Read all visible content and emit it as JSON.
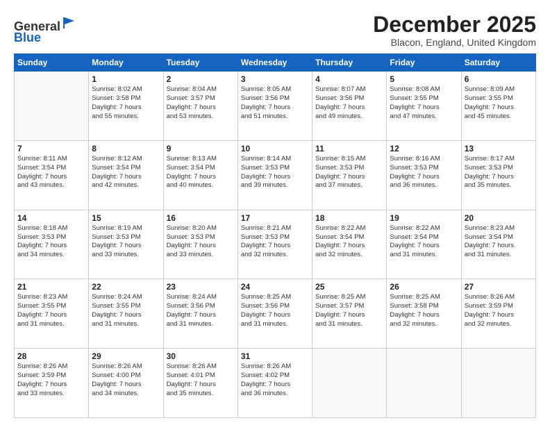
{
  "header": {
    "logo_general": "General",
    "logo_blue": "Blue",
    "month_title": "December 2025",
    "location": "Blacon, England, United Kingdom"
  },
  "days_of_week": [
    "Sunday",
    "Monday",
    "Tuesday",
    "Wednesday",
    "Thursday",
    "Friday",
    "Saturday"
  ],
  "weeks": [
    [
      {
        "day": "",
        "info": ""
      },
      {
        "day": "1",
        "info": "Sunrise: 8:02 AM\nSunset: 3:58 PM\nDaylight: 7 hours\nand 55 minutes."
      },
      {
        "day": "2",
        "info": "Sunrise: 8:04 AM\nSunset: 3:57 PM\nDaylight: 7 hours\nand 53 minutes."
      },
      {
        "day": "3",
        "info": "Sunrise: 8:05 AM\nSunset: 3:56 PM\nDaylight: 7 hours\nand 51 minutes."
      },
      {
        "day": "4",
        "info": "Sunrise: 8:07 AM\nSunset: 3:56 PM\nDaylight: 7 hours\nand 49 minutes."
      },
      {
        "day": "5",
        "info": "Sunrise: 8:08 AM\nSunset: 3:55 PM\nDaylight: 7 hours\nand 47 minutes."
      },
      {
        "day": "6",
        "info": "Sunrise: 8:09 AM\nSunset: 3:55 PM\nDaylight: 7 hours\nand 45 minutes."
      }
    ],
    [
      {
        "day": "7",
        "info": "Sunrise: 8:11 AM\nSunset: 3:54 PM\nDaylight: 7 hours\nand 43 minutes."
      },
      {
        "day": "8",
        "info": "Sunrise: 8:12 AM\nSunset: 3:54 PM\nDaylight: 7 hours\nand 42 minutes."
      },
      {
        "day": "9",
        "info": "Sunrise: 8:13 AM\nSunset: 3:54 PM\nDaylight: 7 hours\nand 40 minutes."
      },
      {
        "day": "10",
        "info": "Sunrise: 8:14 AM\nSunset: 3:53 PM\nDaylight: 7 hours\nand 39 minutes."
      },
      {
        "day": "11",
        "info": "Sunrise: 8:15 AM\nSunset: 3:53 PM\nDaylight: 7 hours\nand 37 minutes."
      },
      {
        "day": "12",
        "info": "Sunrise: 8:16 AM\nSunset: 3:53 PM\nDaylight: 7 hours\nand 36 minutes."
      },
      {
        "day": "13",
        "info": "Sunrise: 8:17 AM\nSunset: 3:53 PM\nDaylight: 7 hours\nand 35 minutes."
      }
    ],
    [
      {
        "day": "14",
        "info": "Sunrise: 8:18 AM\nSunset: 3:53 PM\nDaylight: 7 hours\nand 34 minutes."
      },
      {
        "day": "15",
        "info": "Sunrise: 8:19 AM\nSunset: 3:53 PM\nDaylight: 7 hours\nand 33 minutes."
      },
      {
        "day": "16",
        "info": "Sunrise: 8:20 AM\nSunset: 3:53 PM\nDaylight: 7 hours\nand 33 minutes."
      },
      {
        "day": "17",
        "info": "Sunrise: 8:21 AM\nSunset: 3:53 PM\nDaylight: 7 hours\nand 32 minutes."
      },
      {
        "day": "18",
        "info": "Sunrise: 8:22 AM\nSunset: 3:54 PM\nDaylight: 7 hours\nand 32 minutes."
      },
      {
        "day": "19",
        "info": "Sunrise: 8:22 AM\nSunset: 3:54 PM\nDaylight: 7 hours\nand 31 minutes."
      },
      {
        "day": "20",
        "info": "Sunrise: 8:23 AM\nSunset: 3:54 PM\nDaylight: 7 hours\nand 31 minutes."
      }
    ],
    [
      {
        "day": "21",
        "info": "Sunrise: 8:23 AM\nSunset: 3:55 PM\nDaylight: 7 hours\nand 31 minutes."
      },
      {
        "day": "22",
        "info": "Sunrise: 8:24 AM\nSunset: 3:55 PM\nDaylight: 7 hours\nand 31 minutes."
      },
      {
        "day": "23",
        "info": "Sunrise: 8:24 AM\nSunset: 3:56 PM\nDaylight: 7 hours\nand 31 minutes."
      },
      {
        "day": "24",
        "info": "Sunrise: 8:25 AM\nSunset: 3:56 PM\nDaylight: 7 hours\nand 31 minutes."
      },
      {
        "day": "25",
        "info": "Sunrise: 8:25 AM\nSunset: 3:57 PM\nDaylight: 7 hours\nand 31 minutes."
      },
      {
        "day": "26",
        "info": "Sunrise: 8:25 AM\nSunset: 3:58 PM\nDaylight: 7 hours\nand 32 minutes."
      },
      {
        "day": "27",
        "info": "Sunrise: 8:26 AM\nSunset: 3:59 PM\nDaylight: 7 hours\nand 32 minutes."
      }
    ],
    [
      {
        "day": "28",
        "info": "Sunrise: 8:26 AM\nSunset: 3:59 PM\nDaylight: 7 hours\nand 33 minutes."
      },
      {
        "day": "29",
        "info": "Sunrise: 8:26 AM\nSunset: 4:00 PM\nDaylight: 7 hours\nand 34 minutes."
      },
      {
        "day": "30",
        "info": "Sunrise: 8:26 AM\nSunset: 4:01 PM\nDaylight: 7 hours\nand 35 minutes."
      },
      {
        "day": "31",
        "info": "Sunrise: 8:26 AM\nSunset: 4:02 PM\nDaylight: 7 hours\nand 36 minutes."
      },
      {
        "day": "",
        "info": ""
      },
      {
        "day": "",
        "info": ""
      },
      {
        "day": "",
        "info": ""
      }
    ]
  ]
}
